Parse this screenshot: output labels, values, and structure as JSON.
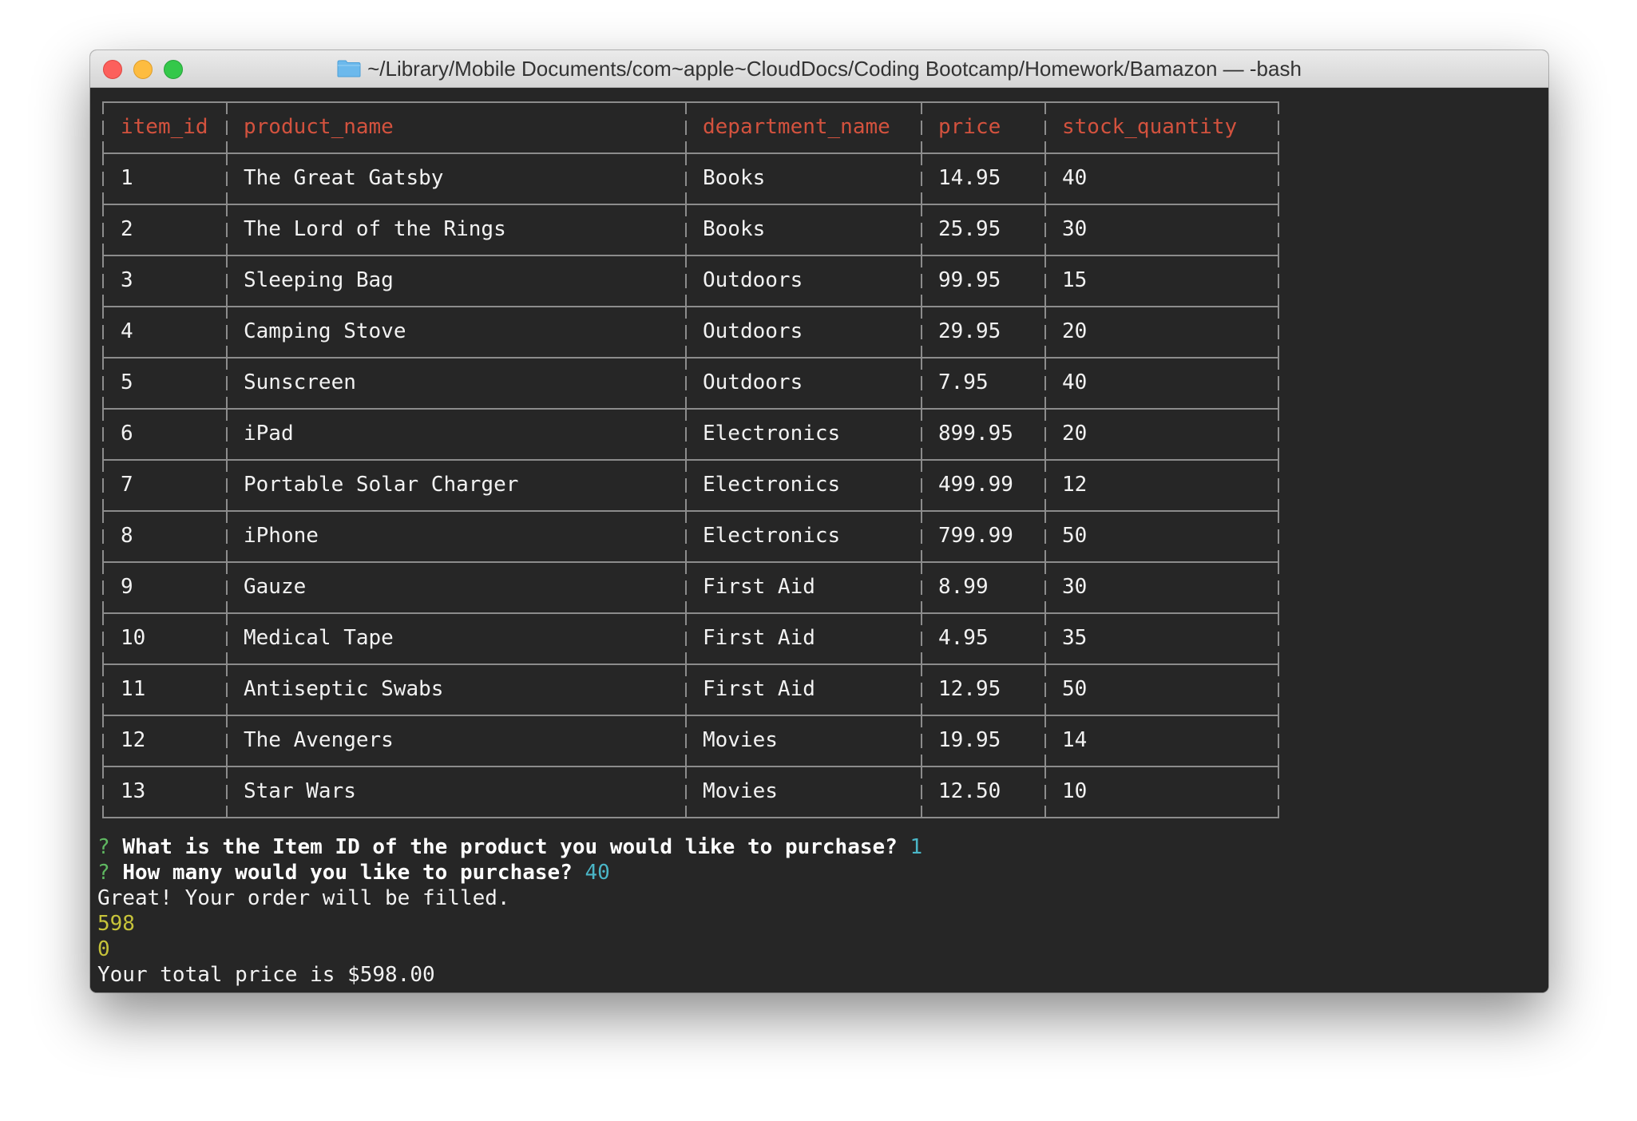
{
  "window": {
    "title": "~/Library/Mobile Documents/com~apple~CloudDocs/Coding Bootcamp/Homework/Bamazon — -bash",
    "folder_icon": "folder-icon"
  },
  "colors": {
    "header_text": "#d3523e",
    "prompt_mark": "#5fb861",
    "answer_text": "#4ab6c7",
    "number_output": "#c6c33a",
    "terminal_bg": "#262626"
  },
  "table": {
    "headers": [
      "item_id",
      "product_name",
      "department_name",
      "price",
      "stock_quantity"
    ],
    "rows": [
      [
        "1",
        "The Great Gatsby",
        "Books",
        "14.95",
        "40"
      ],
      [
        "2",
        "The Lord of the Rings",
        "Books",
        "25.95",
        "30"
      ],
      [
        "3",
        "Sleeping Bag",
        "Outdoors",
        "99.95",
        "15"
      ],
      [
        "4",
        "Camping Stove",
        "Outdoors",
        "29.95",
        "20"
      ],
      [
        "5",
        "Sunscreen",
        "Outdoors",
        "7.95",
        "40"
      ],
      [
        "6",
        "iPad",
        "Electronics",
        "899.95",
        "20"
      ],
      [
        "7",
        "Portable Solar Charger",
        "Electronics",
        "499.99",
        "12"
      ],
      [
        "8",
        "iPhone",
        "Electronics",
        "799.99",
        "50"
      ],
      [
        "9",
        "Gauze",
        "First Aid",
        "8.99",
        "30"
      ],
      [
        "10",
        "Medical Tape",
        "First Aid",
        "4.95",
        "35"
      ],
      [
        "11",
        "Antiseptic Swabs",
        "First Aid",
        "12.95",
        "50"
      ],
      [
        "12",
        "The Avengers",
        "Movies",
        "19.95",
        "14"
      ],
      [
        "13",
        "Star Wars",
        "Movies",
        "12.50",
        "10"
      ]
    ]
  },
  "prompts": {
    "q1_mark": "?",
    "q1_text": "What is the Item ID of the product you would like to purchase?",
    "q1_answer": "1",
    "q2_mark": "?",
    "q2_text": "How many would you like to purchase?",
    "q2_answer": "40",
    "message": "Great! Your order will be filled.",
    "output_1": "598",
    "output_2": "0",
    "total": "Your total price is $598.00"
  }
}
